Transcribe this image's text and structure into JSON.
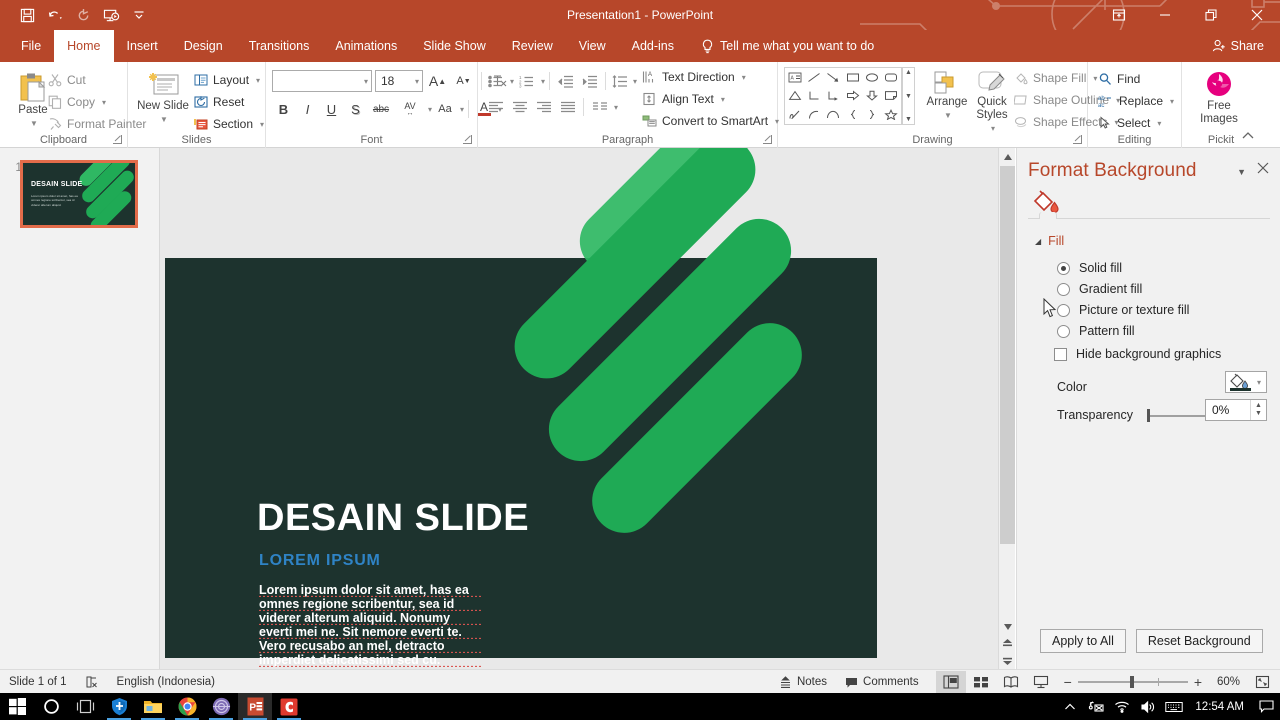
{
  "window": {
    "title": "Presentation1 - PowerPoint",
    "quick_access": [
      "save-icon",
      "undo-icon",
      "redo-icon",
      "start-slideshow-icon",
      "customize-qat-icon"
    ],
    "controls": [
      "ribbon-display-options-icon",
      "minimize-icon",
      "restore-icon",
      "close-icon"
    ]
  },
  "ribbon": {
    "tabs": [
      {
        "label": "File",
        "active": false
      },
      {
        "label": "Home",
        "active": true
      },
      {
        "label": "Insert",
        "active": false
      },
      {
        "label": "Design",
        "active": false
      },
      {
        "label": "Transitions",
        "active": false
      },
      {
        "label": "Animations",
        "active": false
      },
      {
        "label": "Slide Show",
        "active": false
      },
      {
        "label": "Review",
        "active": false
      },
      {
        "label": "View",
        "active": false
      },
      {
        "label": "Add-ins",
        "active": false
      }
    ],
    "tell_me": "Tell me what you want to do",
    "share": "Share",
    "groups": {
      "clipboard": {
        "label": "Clipboard",
        "paste": "Paste",
        "items": [
          {
            "label": "Cut",
            "icon": "scissors-icon"
          },
          {
            "label": "Copy",
            "icon": "copy-icon"
          },
          {
            "label": "Format Painter",
            "icon": "format-painter-icon"
          }
        ]
      },
      "slides": {
        "label": "Slides",
        "new_slide": "New Slide",
        "items": [
          {
            "label": "Layout",
            "icon": "layout-icon"
          },
          {
            "label": "Reset",
            "icon": "reset-icon"
          },
          {
            "label": "Section",
            "icon": "section-icon"
          }
        ]
      },
      "font": {
        "label": "Font",
        "font_name": "",
        "font_name_placeholder": "",
        "font_size": "18",
        "buttons": [
          "increase-font-size",
          "decrease-font-size",
          "clear-formatting",
          "bold",
          "italic",
          "underline",
          "text-shadow",
          "strikethrough",
          "character-spacing",
          "change-case",
          "font-color"
        ],
        "bold": "B",
        "italic": "I",
        "underline": "U",
        "shadow": "S",
        "strike": "abc",
        "spacing": "AV",
        "case": "Aa",
        "color": "A"
      },
      "paragraph": {
        "label": "Paragraph",
        "items": [
          {
            "label": "Text Direction",
            "icon": "text-direction-icon"
          },
          {
            "label": "Align Text",
            "icon": "align-text-icon"
          },
          {
            "label": "Convert to SmartArt",
            "icon": "smartart-icon"
          }
        ]
      },
      "drawing": {
        "label": "Drawing",
        "arrange": "Arrange",
        "quick_styles": "Quick Styles",
        "items": [
          {
            "label": "Shape Fill",
            "icon": "shape-fill-icon"
          },
          {
            "label": "Shape Outline",
            "icon": "shape-outline-icon"
          },
          {
            "label": "Shape Effects",
            "icon": "shape-effects-icon"
          }
        ]
      },
      "editing": {
        "label": "Editing",
        "items": [
          {
            "label": "Find",
            "icon": "search-icon"
          },
          {
            "label": "Replace",
            "icon": "replace-icon"
          },
          {
            "label": "Select",
            "icon": "select-arrow-icon"
          }
        ]
      },
      "pickit": {
        "label": "Pickit",
        "free_images": "Free Images",
        "icon": "pickit-aperture-icon",
        "icon_color": "#e6007e"
      }
    }
  },
  "thumbnails": {
    "slides": [
      {
        "number": "1",
        "title": "DESAIN SLIDE",
        "selected": true,
        "body": "Lorem ipsum dolor sit amet, has ea omnes regione scribentur, sea id viderer alterum aliquid."
      }
    ],
    "selection_color": "#e36c4a"
  },
  "slide": {
    "background_color": "#1d332e",
    "shape_color": "#1faa55",
    "title": "DESAIN SLIDE",
    "subtitle": "LOREM IPSUM",
    "subtitle_color": "#2f83c5",
    "body_lines": [
      "Lorem ipsum dolor sit amet, has ea",
      "omnes regione scribentur, sea id",
      "viderer alterum aliquid. Nonumy",
      "everti mei ne. Sit nemore everti te.",
      "Vero recusabo an mel, detracto",
      "imperdiet delicatissimi sed cu."
    ]
  },
  "format_pane": {
    "title": "Format Background",
    "tab_icon": "fill-bucket-icon",
    "section": "Fill",
    "options": [
      {
        "label": "Solid fill",
        "selected": true
      },
      {
        "label": "Gradient fill",
        "selected": false
      },
      {
        "label": "Picture or texture fill",
        "selected": false
      },
      {
        "label": "Pattern fill",
        "selected": false
      }
    ],
    "checkbox": {
      "label": "Hide background graphics",
      "checked": false
    },
    "color": {
      "label": "Color",
      "swatch_color": "#1d332e"
    },
    "transparency": {
      "label": "Transparency",
      "value": "0%"
    },
    "buttons": [
      {
        "label": "Apply to All"
      },
      {
        "label": "Reset Background"
      }
    ],
    "collapse_icon": "chevron-down-icon",
    "close_icon": "close-icon"
  },
  "status_bar": {
    "slide_count": "Slide 1 of 1",
    "language": "English (Indonesia)",
    "spellcheck_icon": "proofing-error-icon",
    "notes": "Notes",
    "comments": "Comments",
    "views": [
      {
        "name": "normal-view",
        "active": true
      },
      {
        "name": "slide-sorter-view",
        "active": false
      },
      {
        "name": "reading-view",
        "active": false
      },
      {
        "name": "slide-show-view",
        "active": false
      }
    ],
    "zoom": "60%",
    "zoom_out": "−",
    "zoom_in": "+",
    "fit_icon": "fit-slide-icon"
  },
  "taskbar": {
    "items": [
      {
        "name": "start-button",
        "icon": "windows-logo-icon"
      },
      {
        "name": "cortana-button",
        "icon": "cortana-circle-icon"
      },
      {
        "name": "task-view-button",
        "icon": "task-view-icon"
      },
      {
        "name": "windows-defender",
        "icon": "shield-icon"
      },
      {
        "name": "file-explorer",
        "icon": "folder-icon"
      },
      {
        "name": "google-chrome",
        "icon": "chrome-icon"
      },
      {
        "name": "internet-download-manager",
        "icon": "idm-icon"
      },
      {
        "name": "powerpoint",
        "icon": "powerpoint-icon"
      },
      {
        "name": "camtasia",
        "icon": "camtasia-icon"
      }
    ],
    "tray": [
      "show-hidden-icons",
      "network-disconnected-icon",
      "wifi-icon",
      "volume-icon",
      "keyboard-icon"
    ],
    "clock": "12:54 AM",
    "notification_icon": "action-center-icon"
  }
}
